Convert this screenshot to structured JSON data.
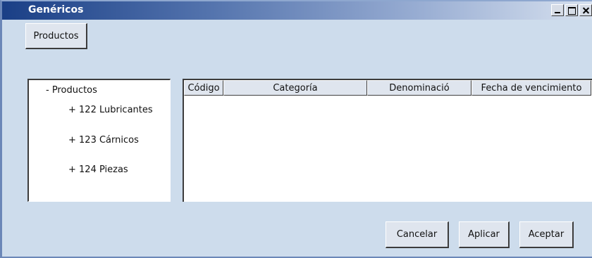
{
  "window": {
    "title": "Genéricos"
  },
  "toolbar": {
    "products_label": "Productos"
  },
  "tree": {
    "root_label": "- Productos",
    "children": [
      "+ 122 Lubricantes",
      "+ 123 Cárnicos",
      "+ 124 Piezas"
    ]
  },
  "table": {
    "columns": [
      "Código",
      "Categoría",
      "Denominació",
      "Fecha de vencimiento"
    ],
    "rows": []
  },
  "actions": {
    "cancel_label": "Cancelar",
    "apply_label": "Aplicar",
    "accept_label": "Aceptar"
  },
  "colors": {
    "title_start": "#1a3f86",
    "window_bg": "#cddcec"
  }
}
